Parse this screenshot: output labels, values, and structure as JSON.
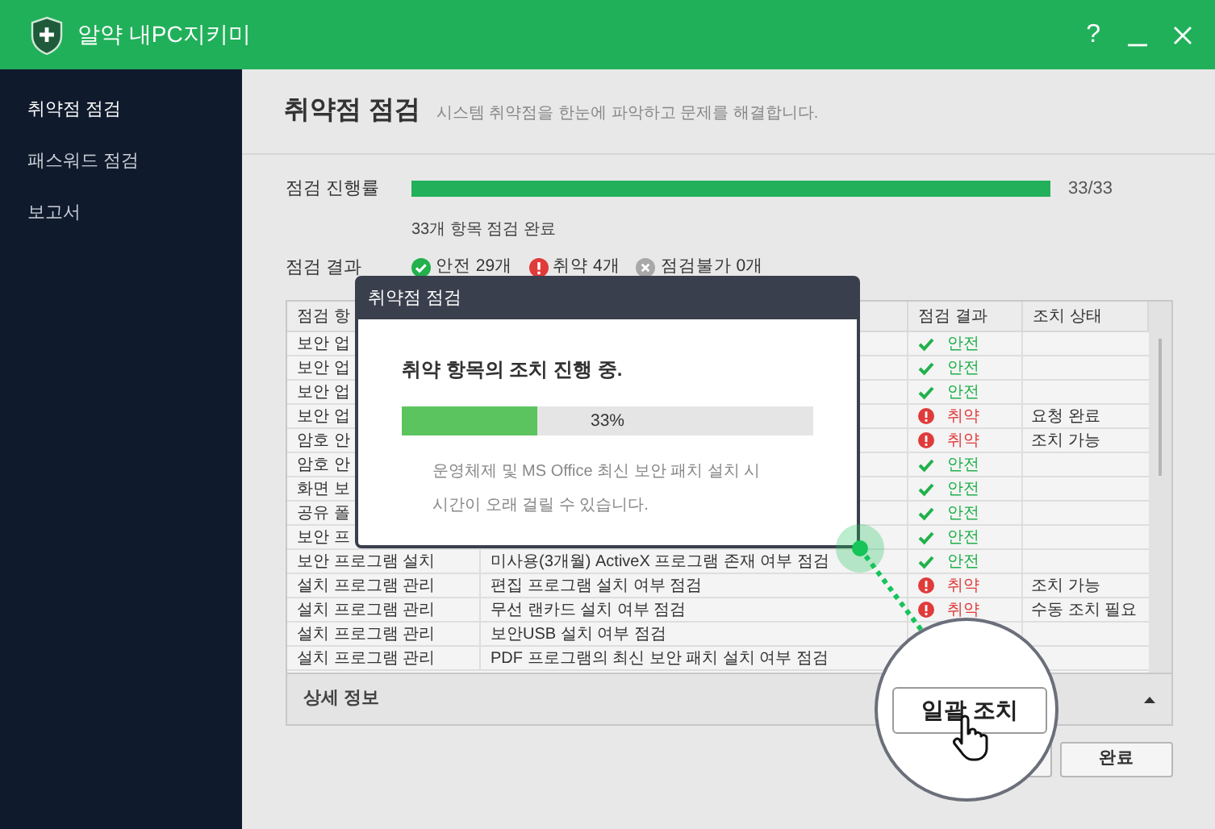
{
  "window": {
    "title": "알약 내PC지키미",
    "help": "?"
  },
  "sidebar": {
    "items": [
      {
        "label": "취약점 점검",
        "selected": true
      },
      {
        "label": "패스워드 점검",
        "selected": false
      },
      {
        "label": "보고서",
        "selected": false
      }
    ]
  },
  "header": {
    "title": "취약점 점검",
    "subtitle": "시스템 취약점을 한눈에 파악하고 문제를 해결합니다."
  },
  "progress": {
    "label": "점검 진행률",
    "level": 1,
    "reading": "33/33",
    "note": "33개 항목 점검 완료"
  },
  "summary": {
    "label": "점검 결과",
    "items": [
      {
        "kind": "safe",
        "text": "안전 29개"
      },
      {
        "kind": "vuln",
        "text": "취약 4개"
      },
      {
        "kind": "na",
        "text": "점검불가 0개"
      }
    ]
  },
  "table": {
    "columns": [
      "점검 항",
      "점검 결과",
      "조치 상태"
    ],
    "rows": [
      {
        "category": "보안 업",
        "result": {
          "kind": "safe",
          "text": "안전"
        }
      },
      {
        "category": "보안 업",
        "result": {
          "kind": "safe",
          "text": "안전"
        }
      },
      {
        "category": "보안 업",
        "result": {
          "kind": "safe",
          "text": "안전"
        }
      },
      {
        "category": "보안 업",
        "result": {
          "kind": "vuln",
          "text": "취약"
        },
        "action": "요청 완료"
      },
      {
        "category": "암호 안",
        "result": {
          "kind": "vuln",
          "text": "취약"
        },
        "action": "조치 가능"
      },
      {
        "category": "암호 안",
        "result": {
          "kind": "safe",
          "text": "안전"
        }
      },
      {
        "category": "화면 보",
        "result": {
          "kind": "safe",
          "text": "안전"
        }
      },
      {
        "category": "공유 폴",
        "result": {
          "kind": "safe",
          "text": "안전"
        }
      },
      {
        "category": "보안 프",
        "result": {
          "kind": "safe",
          "text": "안전"
        }
      },
      {
        "category": "보안 프로그램 설치",
        "item": "미사용(3개월) ActiveX 프로그램 존재 여부 점검",
        "result": {
          "kind": "safe",
          "text": "안전"
        }
      },
      {
        "category": "설치 프로그램 관리",
        "item": "편집 프로그램 설치 여부 점검",
        "result": {
          "kind": "vuln",
          "text": "취약"
        },
        "action": "조치 가능"
      },
      {
        "category": "설치 프로그램 관리",
        "item": "무선 랜카드 설치 여부 점검",
        "result": {
          "kind": "vuln",
          "text": "취약"
        },
        "action": "수동 조치 필요"
      },
      {
        "category": "설치 프로그램 관리",
        "item": "보안USB 설치 여부 점검"
      },
      {
        "category": "설치 프로그램 관리",
        "item": "PDF 프로그램의 최신 보안 패치 설치 여부 점검"
      }
    ]
  },
  "details": {
    "label": "상세 정보",
    "expanded": false
  },
  "buttons": {
    "done": "완료"
  },
  "dialog": {
    "title": "취약점 점검",
    "message": "취약 항목의 조치 진행 중.",
    "level": 0.33,
    "reading": "33%",
    "note": [
      "운영체제 및 MS Office 최신 보안 패치 설치 시",
      "시간이 오래 걸릴 수 있습니다."
    ]
  },
  "callout": {
    "button": "일괄 조치"
  }
}
